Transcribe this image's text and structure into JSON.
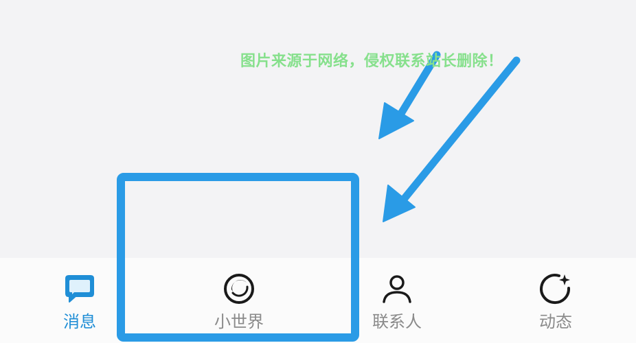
{
  "watermark": {
    "text": "图片来源于网络，侵权联系站长删除！"
  },
  "tabs": [
    {
      "id": "messages",
      "label": "消息",
      "icon": "message-bubble-icon",
      "active": true
    },
    {
      "id": "world",
      "label": "小世界",
      "icon": "planet-icon",
      "active": false
    },
    {
      "id": "contacts",
      "label": "联系人",
      "icon": "person-icon",
      "active": false
    },
    {
      "id": "moments",
      "label": "动态",
      "icon": "refresh-star-icon",
      "active": false
    }
  ],
  "colors": {
    "active": "#1f8ed6",
    "inactive": "#8a8a8a",
    "icon_dark": "#1a1a1a",
    "annotation": "#2a9be6",
    "watermark": "#86e08c"
  }
}
